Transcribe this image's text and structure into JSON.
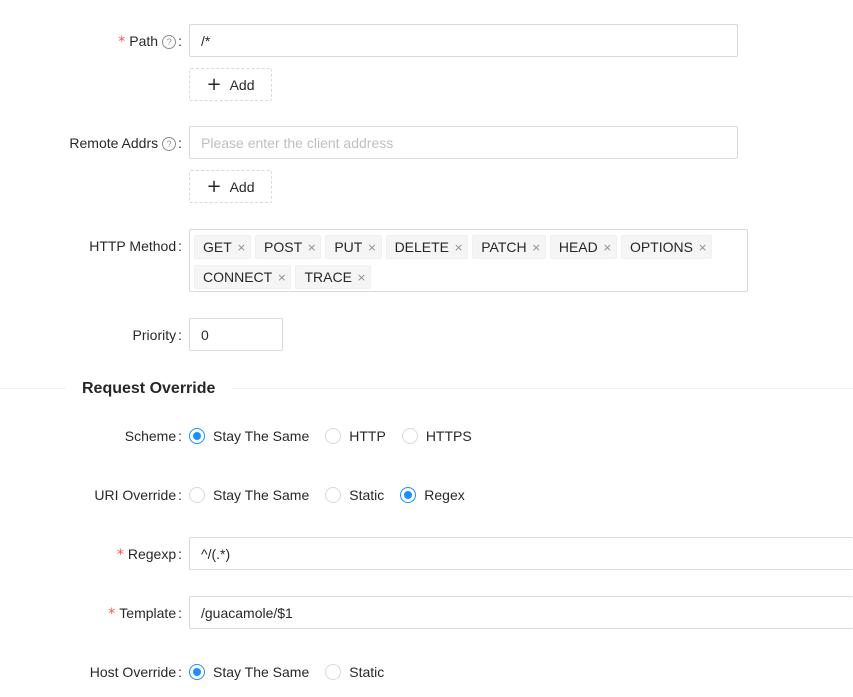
{
  "path": {
    "label": "Path",
    "value": "/*",
    "add_label": "Add"
  },
  "remote_addrs": {
    "label": "Remote Addrs",
    "placeholder": "Please enter the client address",
    "add_label": "Add"
  },
  "http_method": {
    "label": "HTTP Method",
    "tags": [
      "GET",
      "POST",
      "PUT",
      "DELETE",
      "PATCH",
      "HEAD",
      "OPTIONS",
      "CONNECT",
      "TRACE"
    ]
  },
  "priority": {
    "label": "Priority",
    "value": "0"
  },
  "request_override": {
    "title": "Request Override"
  },
  "scheme": {
    "label": "Scheme",
    "options": [
      "Stay The Same",
      "HTTP",
      "HTTPS"
    ],
    "selected": "Stay The Same"
  },
  "uri_override": {
    "label": "URI Override",
    "options": [
      "Stay The Same",
      "Static",
      "Regex"
    ],
    "selected": "Regex"
  },
  "regexp": {
    "label": "Regexp",
    "value": "^/(.*)"
  },
  "template": {
    "label": "Template",
    "value": "/guacamole/$1"
  },
  "host_override": {
    "label": "Host Override",
    "options": [
      "Stay The Same",
      "Static"
    ],
    "selected": "Stay The Same"
  },
  "colors": {
    "primary": "#1890ff",
    "required": "#ff4d4f",
    "border": "#d9d9d9"
  }
}
